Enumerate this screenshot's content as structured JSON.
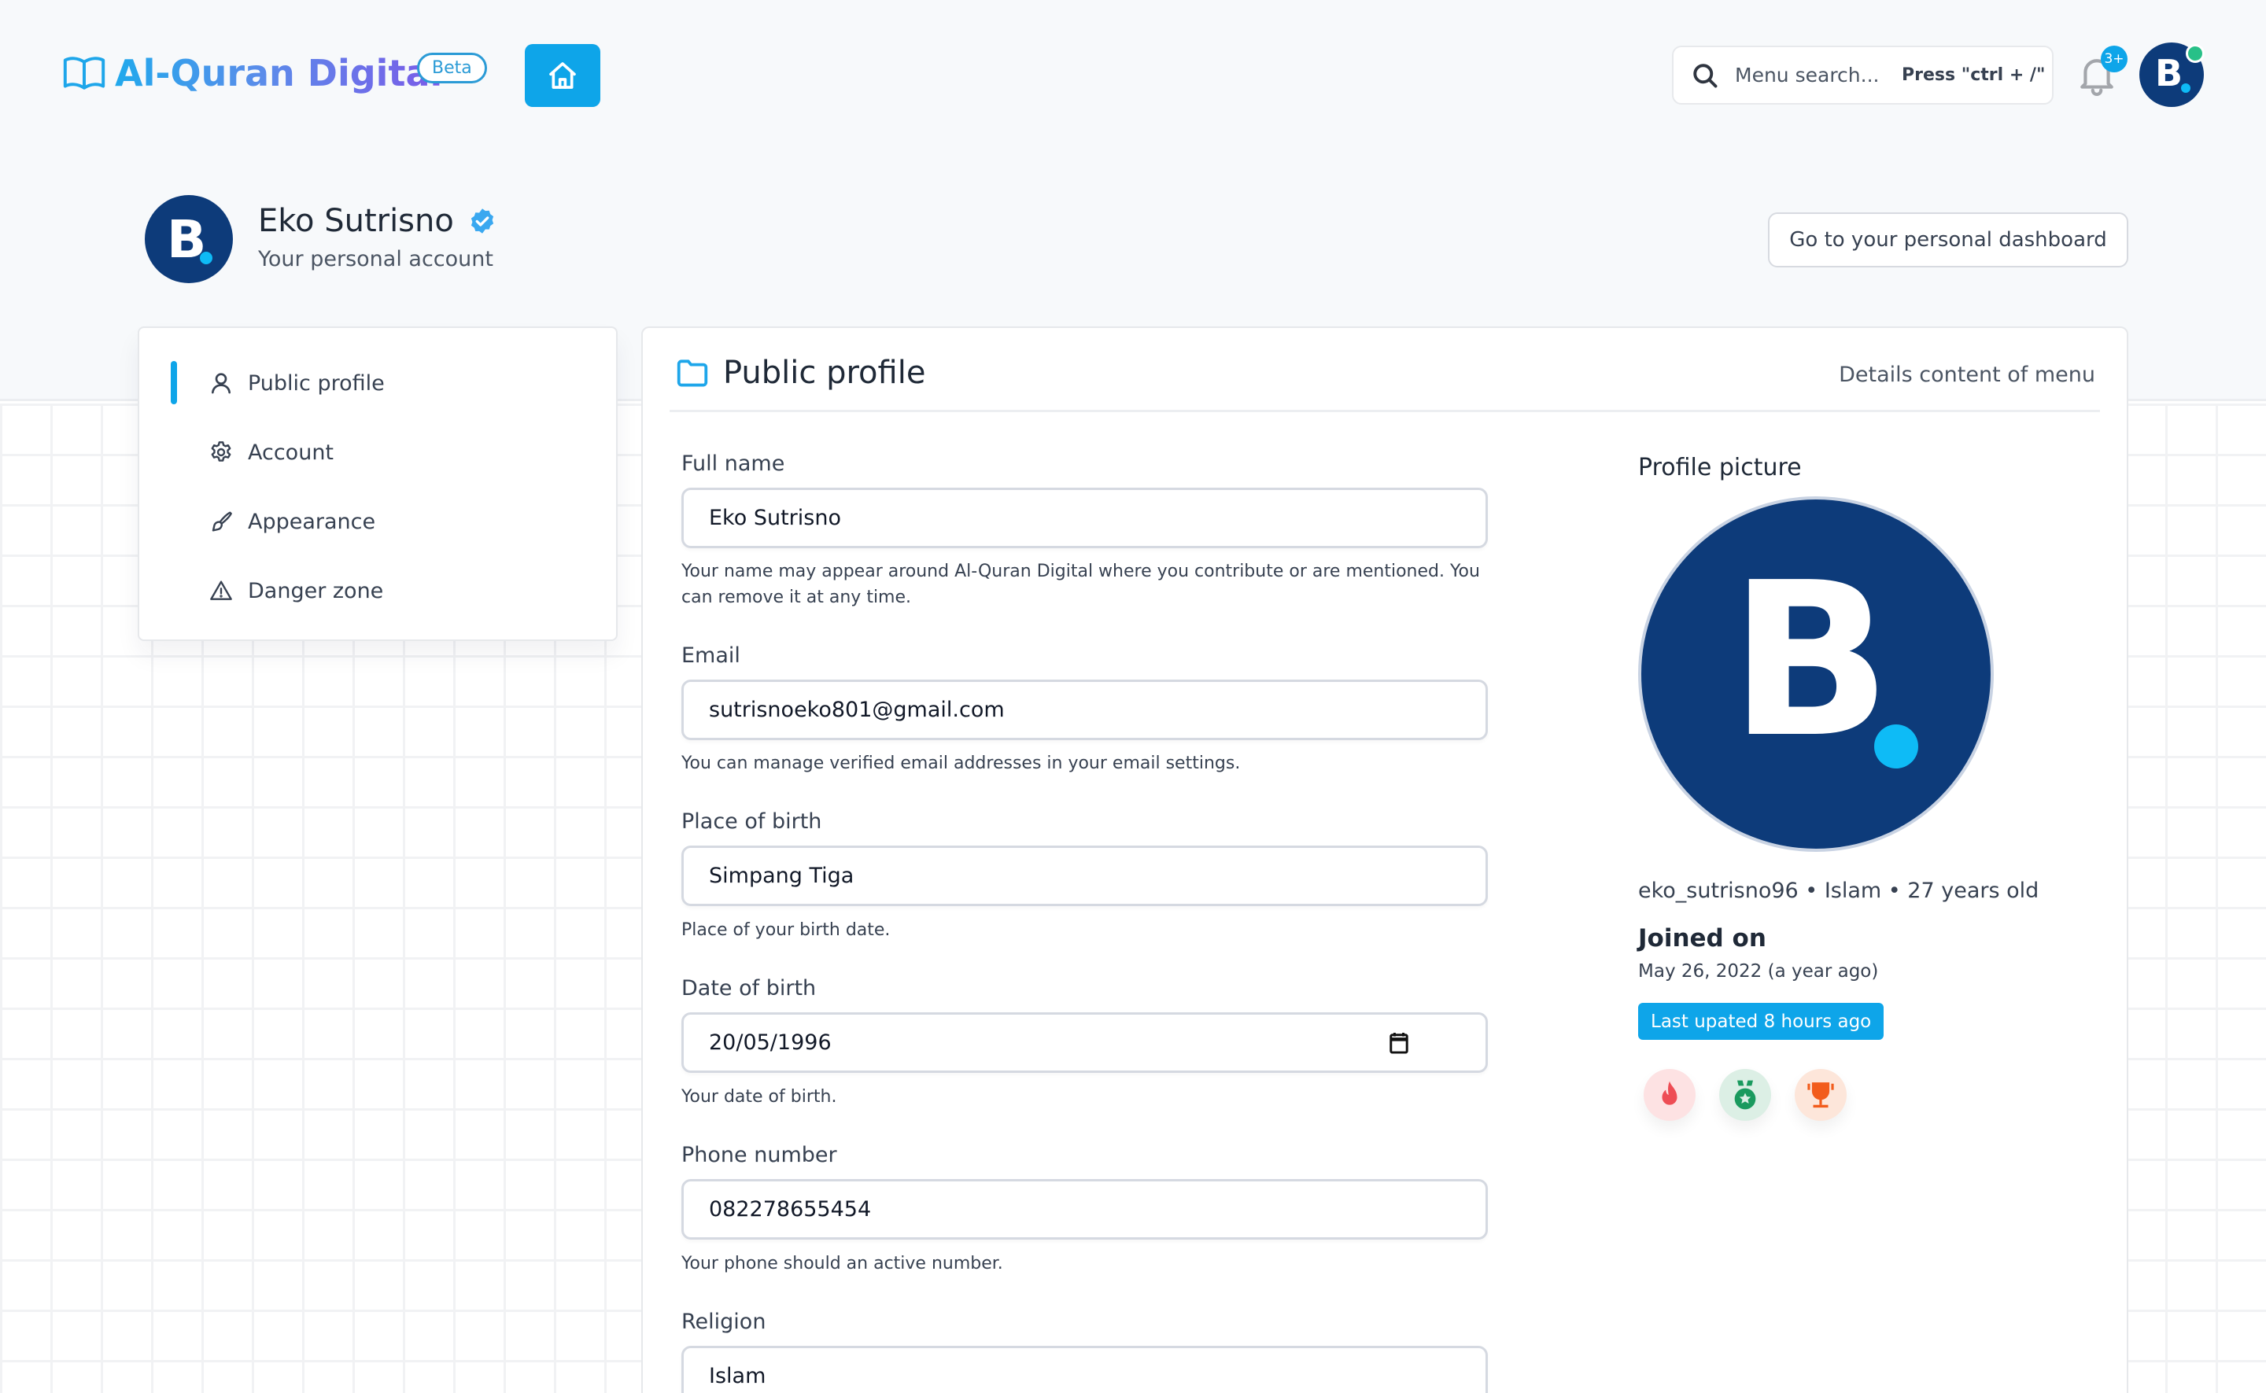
{
  "header": {
    "app_title": "Al-Quran Digital",
    "beta_label": "Beta",
    "search": {
      "placeholder": "Menu search...",
      "shortcut_hint": "Press \"ctrl + /\""
    },
    "notifications_count": "3+",
    "avatar_letter": "B"
  },
  "profile_header": {
    "name": "Eko Sutrisno",
    "subtitle": "Your personal account",
    "dashboard_button": "Go to your personal dashboard"
  },
  "sidebar": {
    "items": [
      {
        "label": "Public profile",
        "icon": "user-icon",
        "active": true
      },
      {
        "label": "Account",
        "icon": "gear-icon",
        "active": false
      },
      {
        "label": "Appearance",
        "icon": "brush-icon",
        "active": false
      },
      {
        "label": "Danger zone",
        "icon": "warning-icon",
        "active": false
      }
    ]
  },
  "main": {
    "title": "Public profile",
    "subtitle": "Details content of menu",
    "fields": {
      "full_name": {
        "label": "Full name",
        "value": "Eko Sutrisno",
        "help": "Your name may appear around Al-Quran Digital where you contribute or are mentioned. You can remove it at any time."
      },
      "email": {
        "label": "Email",
        "value": "sutrisnoeko801@gmail.com",
        "help": "You can manage verified email addresses in your email settings."
      },
      "place_of_birth": {
        "label": "Place of birth",
        "value": "Simpang Tiga",
        "help": "Place of your birth date."
      },
      "date_of_birth": {
        "label": "Date of birth",
        "value": "20/05/1996",
        "help": "Your date of birth."
      },
      "phone": {
        "label": "Phone number",
        "value": "082278655454",
        "help": "Your phone should an active number."
      },
      "religion": {
        "label": "Religion",
        "value": "Islam"
      }
    },
    "profile_picture": {
      "label": "Profile picture",
      "letter": "B",
      "meta": "eko_sutrisno96 • Islam • 27 years old",
      "joined_title": "Joined on",
      "joined_date": "May 26, 2022 (a year ago)",
      "updated_badge": "Last upated 8 hours ago",
      "awards": [
        {
          "icon": "fire-icon",
          "color": "#ee4d55",
          "bg": "#fde2e3"
        },
        {
          "icon": "medal-icon",
          "color": "#1a9a5e",
          "bg": "#dcefe5"
        },
        {
          "icon": "trophy-icon",
          "color": "#f25c1c",
          "bg": "#fde6da"
        }
      ]
    }
  },
  "colors": {
    "accent": "#0ea5e9",
    "avatar_bg": "#0d3b7a",
    "avatar_dot": "#0ebbf6",
    "online": "#28c088"
  }
}
